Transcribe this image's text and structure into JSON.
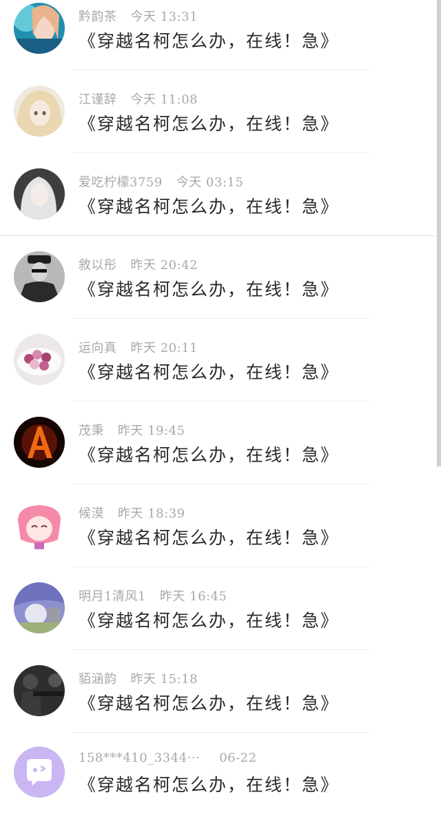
{
  "comments": [
    {
      "name": "黔韵茶",
      "time": "今天 13:31",
      "message": "《穿越名柯怎么办，在线！急》",
      "avatar_icon": "teal-anime-avatar"
    },
    {
      "name": "江谨辞",
      "time": "今天 11:08",
      "message": "《穿越名柯怎么办，在线！急》",
      "avatar_icon": "blonde-anime-avatar"
    },
    {
      "name": "爱吃柠檬3759",
      "time": "今天 03:15",
      "message": "《穿越名柯怎么办，在线！急》",
      "avatar_icon": "white-hair-avatar"
    },
    {
      "name": "敘以彤",
      "time": "昨天 20:42",
      "message": "《穿越名柯怎么办，在线！急》",
      "avatar_icon": "bw-photo-avatar"
    },
    {
      "name": "运向真",
      "time": "昨天 20:11",
      "message": "《穿越名柯怎么办，在线！急》",
      "avatar_icon": "sweets-avatar"
    },
    {
      "name": "茂秉",
      "time": "昨天 19:45",
      "message": "《穿越名柯怎么办，在线！急》",
      "avatar_icon": "fire-letter-a-avatar"
    },
    {
      "name": "候漠",
      "time": "昨天 18:39",
      "message": "《穿越名柯怎么办，在线！急》",
      "avatar_icon": "pink-cartoon-avatar"
    },
    {
      "name": "明月1清风1",
      "time": "昨天 16:45",
      "message": "《穿越名柯怎么办，在线！急》",
      "avatar_icon": "purple-cartoon-avatar"
    },
    {
      "name": "貊涵韵",
      "time": "昨天 15:18",
      "message": "《穿越名柯怎么办，在线！急》",
      "avatar_icon": "game-soldier-avatar"
    },
    {
      "name": "158***410_3344···",
      "time": "06-22",
      "message": "《穿越名柯怎么办，在线！急》",
      "avatar_icon": "default-chat-avatar"
    }
  ],
  "colors": {
    "name": "#a8a8a8",
    "message": "#2a2a2a",
    "divider": "#ececec",
    "default_avatar": "#c9b6f2"
  }
}
